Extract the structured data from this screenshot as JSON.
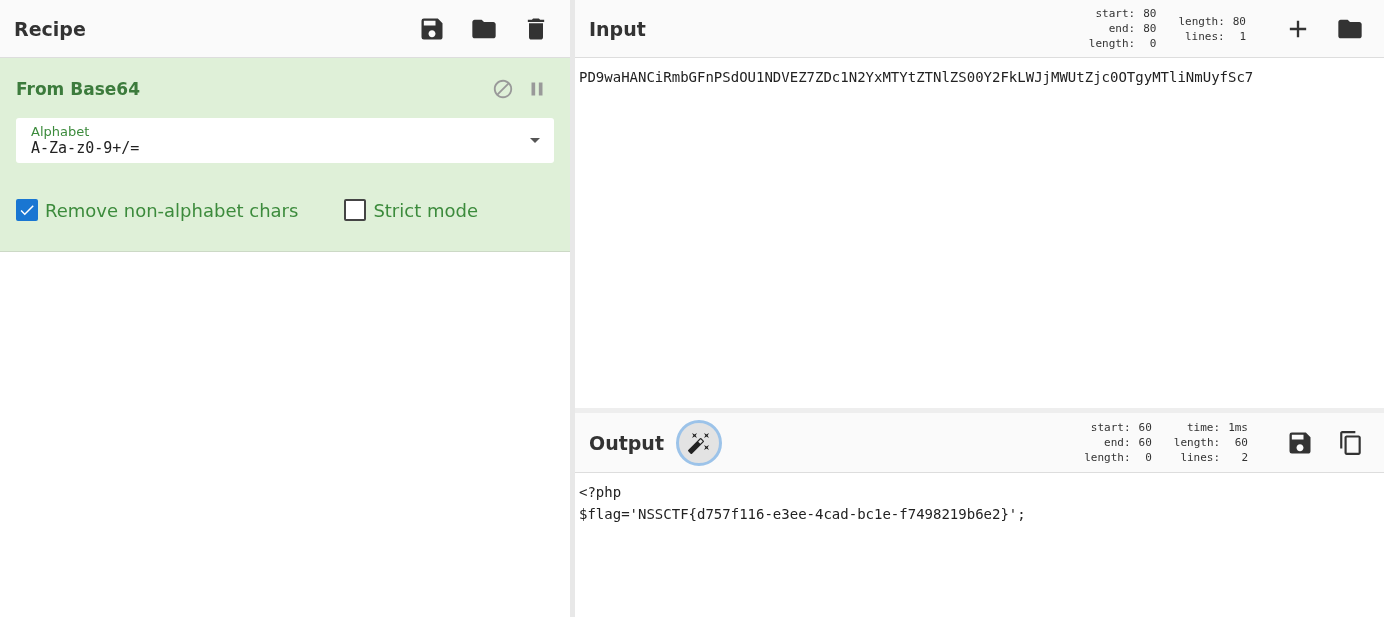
{
  "recipe": {
    "title": "Recipe",
    "operation": {
      "name": "From Base64",
      "disabled": false,
      "paused": false,
      "alphabet": {
        "label": "Alphabet",
        "value": "A-Za-z0-9+/="
      },
      "options": [
        {
          "label": "Remove non-alphabet chars",
          "checked": true
        },
        {
          "label": "Strict mode",
          "checked": false
        }
      ]
    }
  },
  "input": {
    "title": "Input",
    "stats": [
      [
        {
          "label": "start:",
          "value": "80"
        },
        {
          "label": "end:",
          "value": "80"
        },
        {
          "label": "length:",
          "value": "0"
        }
      ],
      [
        {
          "label": "length:",
          "value": "80"
        },
        {
          "label": "lines:",
          "value": "1"
        }
      ]
    ],
    "lines": [
      "PD9waHANCiRmbGFnPSdOU1NDVEZ7ZDc1N2YxMTYtZTNlZS00Y2FkLWJjMWUtZjc0OTgyMTliNmUyfSc7"
    ]
  },
  "output": {
    "title": "Output",
    "stats": [
      [
        {
          "label": "start:",
          "value": "60"
        },
        {
          "label": "end:",
          "value": "60"
        },
        {
          "label": "length:",
          "value": "0"
        }
      ],
      [
        {
          "label": "time:",
          "value": "1ms"
        },
        {
          "label": "length:",
          "value": "60"
        },
        {
          "label": "lines:",
          "value": "2"
        }
      ]
    ],
    "lines": [
      "<?php",
      "$flag='NSSCTF{d757f116-e3ee-4cad-bc1e-f7498219b6e2}';"
    ]
  }
}
